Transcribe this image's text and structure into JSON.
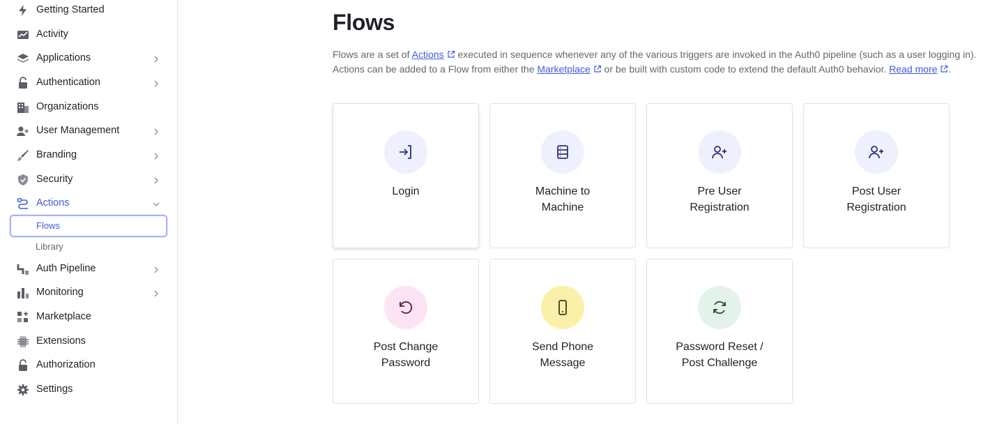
{
  "sidebar": {
    "items": [
      {
        "label": "Getting Started",
        "icon": "bolt-icon"
      },
      {
        "label": "Activity",
        "icon": "chart-line-icon"
      },
      {
        "label": "Applications",
        "icon": "layers-icon",
        "chevron": true
      },
      {
        "label": "Authentication",
        "icon": "lock-icon",
        "chevron": true
      },
      {
        "label": "Organizations",
        "icon": "building-icon"
      },
      {
        "label": "User Management",
        "icon": "users-icon",
        "chevron": true
      },
      {
        "label": "Branding",
        "icon": "brush-icon",
        "chevron": true
      },
      {
        "label": "Security",
        "icon": "shield-icon",
        "chevron": true
      },
      {
        "label": "Actions",
        "icon": "actions-icon",
        "chevron": "down",
        "active": true
      },
      {
        "label": "Auth Pipeline",
        "icon": "pipeline-icon",
        "chevron": true
      },
      {
        "label": "Monitoring",
        "icon": "bar-chart-icon",
        "chevron": true
      },
      {
        "label": "Marketplace",
        "icon": "grid-plus-icon"
      },
      {
        "label": "Extensions",
        "icon": "chip-icon"
      },
      {
        "label": "Authorization",
        "icon": "lock-icon"
      },
      {
        "label": "Settings",
        "icon": "gear-icon"
      }
    ],
    "actions_sub": [
      {
        "label": "Flows",
        "selected": true
      },
      {
        "label": "Library",
        "selected": false
      }
    ]
  },
  "main": {
    "title": "Flows",
    "desc_line1": {
      "pre": "Flows are a set of ",
      "link1": "Actions",
      "post": " executed in sequence whenever any of the various triggers are invoked in the Auth0 pipeline (such as a user logging in)."
    },
    "desc_line2": {
      "pre": "Actions can be added to a Flow from either the ",
      "link1": "Marketplace",
      "mid": " or be built with custom code to extend the default Auth0 behavior. ",
      "link2": "Read more",
      "post": "."
    },
    "cards": [
      {
        "label": "Login",
        "icon": "login-icon",
        "bg": "#eef0fd"
      },
      {
        "label": "Machine to\nMachine",
        "icon": "server-icon",
        "bg": "#eef0fd"
      },
      {
        "label": "Pre User\nRegistration",
        "icon": "user-plus-icon",
        "bg": "#eef0fd"
      },
      {
        "label": "Post User\nRegistration",
        "icon": "user-plus-icon",
        "bg": "#eef0fd"
      },
      {
        "label": "Post Change\nPassword",
        "icon": "rotate-ccw-icon",
        "bg": "#fde4f4"
      },
      {
        "label": "Send Phone\nMessage",
        "icon": "phone-icon",
        "bg": "#fbf0a8"
      },
      {
        "label": "Password Reset /\nPost Challenge",
        "icon": "refresh-icon",
        "bg": "#e3f3ea"
      }
    ]
  },
  "colors": {
    "accent": "#3f59e4",
    "text": "#1e212a",
    "muted": "#65676e",
    "border": "#dfe1e6"
  }
}
